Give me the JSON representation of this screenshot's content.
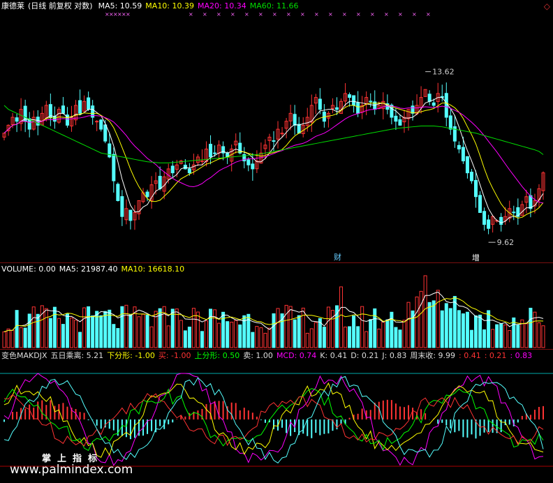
{
  "header": {
    "stock": "康德莱",
    "mode": "(日线 前复权 对数)",
    "ma": [
      {
        "label": "MA5: 10.59",
        "color": "#ffffff"
      },
      {
        "label": "MA10: 10.39",
        "color": "#ffff00"
      },
      {
        "label": "MA20: 10.34",
        "color": "#ff00ff"
      },
      {
        "label": "MA60: 11.66",
        "color": "#00dd00"
      }
    ],
    "corner_icon": "diamond-icon"
  },
  "volume_header": {
    "label": "VOLUME: 0.00",
    "ma5": "MA5: 21987.40",
    "ma10": "MA10: 16618.10"
  },
  "indicator_header": {
    "items": [
      {
        "label": "变色MAKDJX",
        "color": "#dddddd"
      },
      {
        "label": "五日乘离: 5.21",
        "color": "#dddddd"
      },
      {
        "label": "下分形: -1.00",
        "color": "#ffff00"
      },
      {
        "label": "买: -1.00",
        "color": "#ff3333"
      },
      {
        "label": "上分形: 0.50",
        "color": "#00ff00"
      },
      {
        "label": "卖: 1.00",
        "color": "#dddddd"
      },
      {
        "label": "MCD: 0.74",
        "color": "#ff00ff"
      },
      {
        "label": "K: 0.41",
        "color": "#dddddd"
      },
      {
        "label": "D: 0.21",
        "color": "#dddddd"
      },
      {
        "label": "J: 0.83",
        "color": "#dddddd"
      },
      {
        "label": "周末收: 9.99",
        "color": "#dddddd"
      },
      {
        "label": ": 0.41",
        "color": "#ff3333"
      },
      {
        "label": ": 0.21",
        "color": "#ff3333"
      },
      {
        "label": ": 0.83",
        "color": "#ff00ff"
      }
    ]
  },
  "markers": {
    "cai": "财",
    "zeng": "增"
  },
  "watermark": {
    "line1": "掌上指标",
    "line2": "www.palmindex.com"
  },
  "chart_data": {
    "type": "candlestick",
    "price_annotations": {
      "high": "13.62",
      "low": "9.62"
    },
    "price_range": [
      9.4,
      14.5
    ],
    "colors": {
      "up": "#ff3333",
      "down": "#54ffff",
      "ma5": "#ffffff",
      "ma10": "#ffff00",
      "ma20": "#ff00ff",
      "ma60": "#00dd00"
    },
    "closes": [
      12.2,
      12.4,
      12.6,
      12.5,
      12.8,
      12.5,
      12.3,
      12.6,
      12.4,
      12.7,
      12.9,
      12.6,
      12.5,
      12.8,
      12.7,
      12.4,
      12.6,
      12.9,
      12.7,
      13.0,
      12.8,
      12.6,
      12.5,
      12.3,
      12.0,
      11.6,
      11.0,
      10.5,
      10.1,
      10.3,
      10.0,
      10.2,
      10.5,
      10.7,
      10.6,
      10.9,
      11.0,
      10.8,
      11.1,
      11.3,
      11.2,
      11.4,
      11.5,
      11.3,
      11.2,
      11.4,
      11.6,
      11.5,
      11.8,
      11.6,
      11.7,
      11.9,
      11.7,
      11.6,
      11.8,
      12.0,
      11.7,
      11.5,
      11.4,
      11.3,
      11.5,
      11.7,
      11.9,
      12.1,
      12.0,
      12.3,
      12.2,
      12.5,
      12.7,
      12.4,
      12.2,
      12.4,
      12.6,
      12.9,
      13.1,
      12.8,
      12.5,
      12.7,
      12.9,
      12.8,
      13.0,
      13.2,
      13.1,
      12.9,
      12.7,
      12.9,
      13.1,
      13.0,
      12.8,
      12.9,
      13.0,
      12.8,
      12.6,
      12.5,
      12.4,
      12.6,
      12.8,
      12.7,
      12.9,
      13.1,
      13.3,
      13.0,
      12.9,
      13.2,
      13.1,
      12.6,
      12.3,
      12.0,
      11.8,
      11.5,
      11.2,
      11.0,
      10.6,
      10.2,
      9.9,
      9.8,
      10.1,
      10.0,
      9.9,
      10.1,
      10.3,
      10.2,
      10.1,
      10.4,
      10.6,
      10.3,
      10.5,
      10.8,
      11.2
    ],
    "ma60": [
      12.9,
      12.8,
      12.75,
      12.7,
      12.65,
      12.6,
      12.55,
      12.5,
      12.45,
      12.4,
      12.35,
      12.3,
      12.25,
      12.2,
      12.15,
      12.1,
      12.05,
      12.0,
      11.95,
      11.9,
      11.85,
      11.8,
      11.75,
      11.7,
      11.68,
      11.66,
      11.64,
      11.62,
      11.6,
      11.58,
      11.56,
      11.54,
      11.52,
      11.5,
      11.48,
      11.47,
      11.46,
      11.45,
      11.45,
      11.45,
      11.46,
      11.47,
      11.48,
      11.49,
      11.5,
      11.51,
      11.52,
      11.53,
      11.54,
      11.55,
      11.56,
      11.57,
      11.58,
      11.59,
      11.6,
      11.61,
      11.62,
      11.63,
      11.64,
      11.65,
      11.66,
      11.68,
      11.7,
      11.72,
      11.74,
      11.76,
      11.78,
      11.8,
      11.82,
      11.84,
      11.86,
      11.88,
      11.9,
      11.92,
      11.94,
      11.96,
      11.98,
      12.0,
      12.02,
      12.04,
      12.06,
      12.08,
      12.1,
      12.12,
      12.14,
      12.16,
      12.18,
      12.2,
      12.22,
      12.24,
      12.26,
      12.28,
      12.3,
      12.32,
      12.33,
      12.34,
      12.35,
      12.36,
      12.37,
      12.38,
      12.38,
      12.38,
      12.38,
      12.37,
      12.36,
      12.34,
      12.32,
      12.3,
      12.28,
      12.26,
      12.24,
      12.22,
      12.2,
      12.17,
      12.14,
      12.11,
      12.08,
      12.05,
      12.02,
      11.99,
      11.96,
      11.93,
      11.9,
      11.87,
      11.84,
      11.81,
      11.78,
      11.74,
      11.66
    ]
  }
}
